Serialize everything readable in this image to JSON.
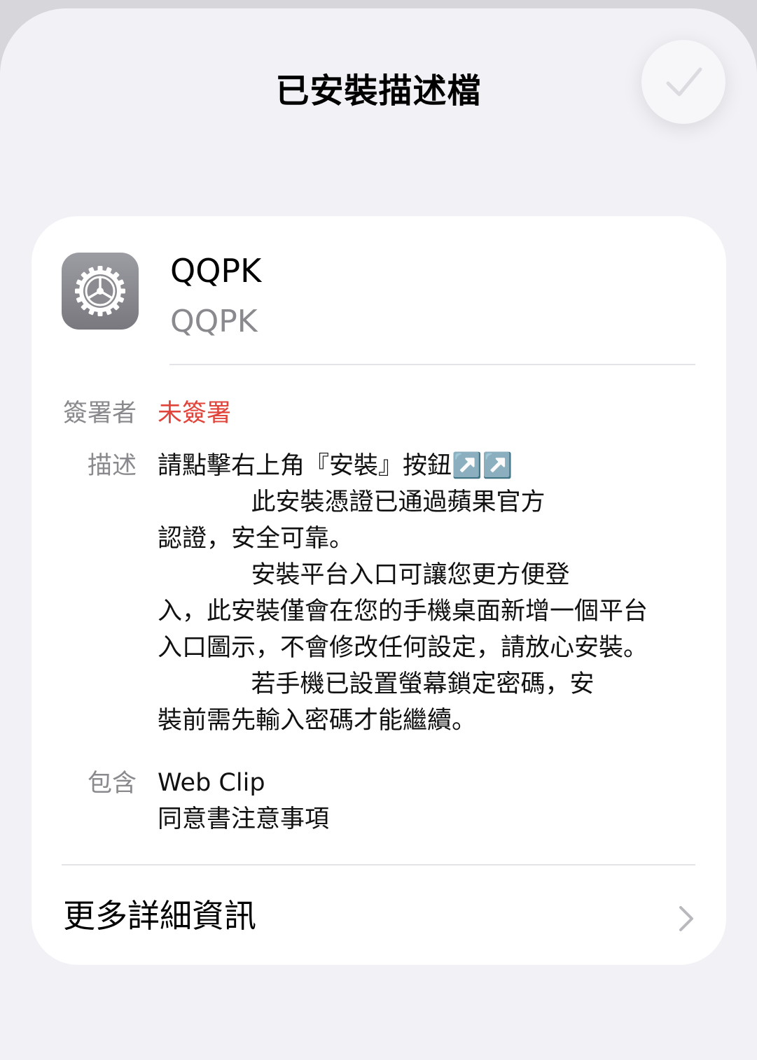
{
  "sheet": {
    "title": "已安裝描述檔",
    "done_icon": "checkmark-icon"
  },
  "profile": {
    "icon": "settings-gear-icon",
    "name": "QQPK",
    "organization": "QQPK"
  },
  "details": {
    "signer_label": "簽署者",
    "signer_value": "未簽署",
    "description_label": "描述",
    "description_value": "請點擊右上角『安裝』按鈕↗️↗️\n            此安裝憑證已通過蘋果官方\n認證，安全可靠。\n            安裝平台入口可讓您更方便登\n入，此安裝僅會在您的手機桌面新增一個平台\n入口圖示，不會修改任何設定，請放心安裝。\n            若手機已設置螢幕鎖定密碼，安\n裝前需先輸入密碼才能繼續。",
    "contains_label": "包含",
    "contains_items": [
      "Web Clip",
      "同意書注意事項"
    ]
  },
  "more": {
    "label": "更多詳細資訊",
    "icon": "chevron-right-icon"
  },
  "colors": {
    "unsigned_red": "#e0443a",
    "secondary_gray": "#8a8a8e",
    "sheet_background": "#f1f1f6",
    "card_background": "#ffffff"
  }
}
